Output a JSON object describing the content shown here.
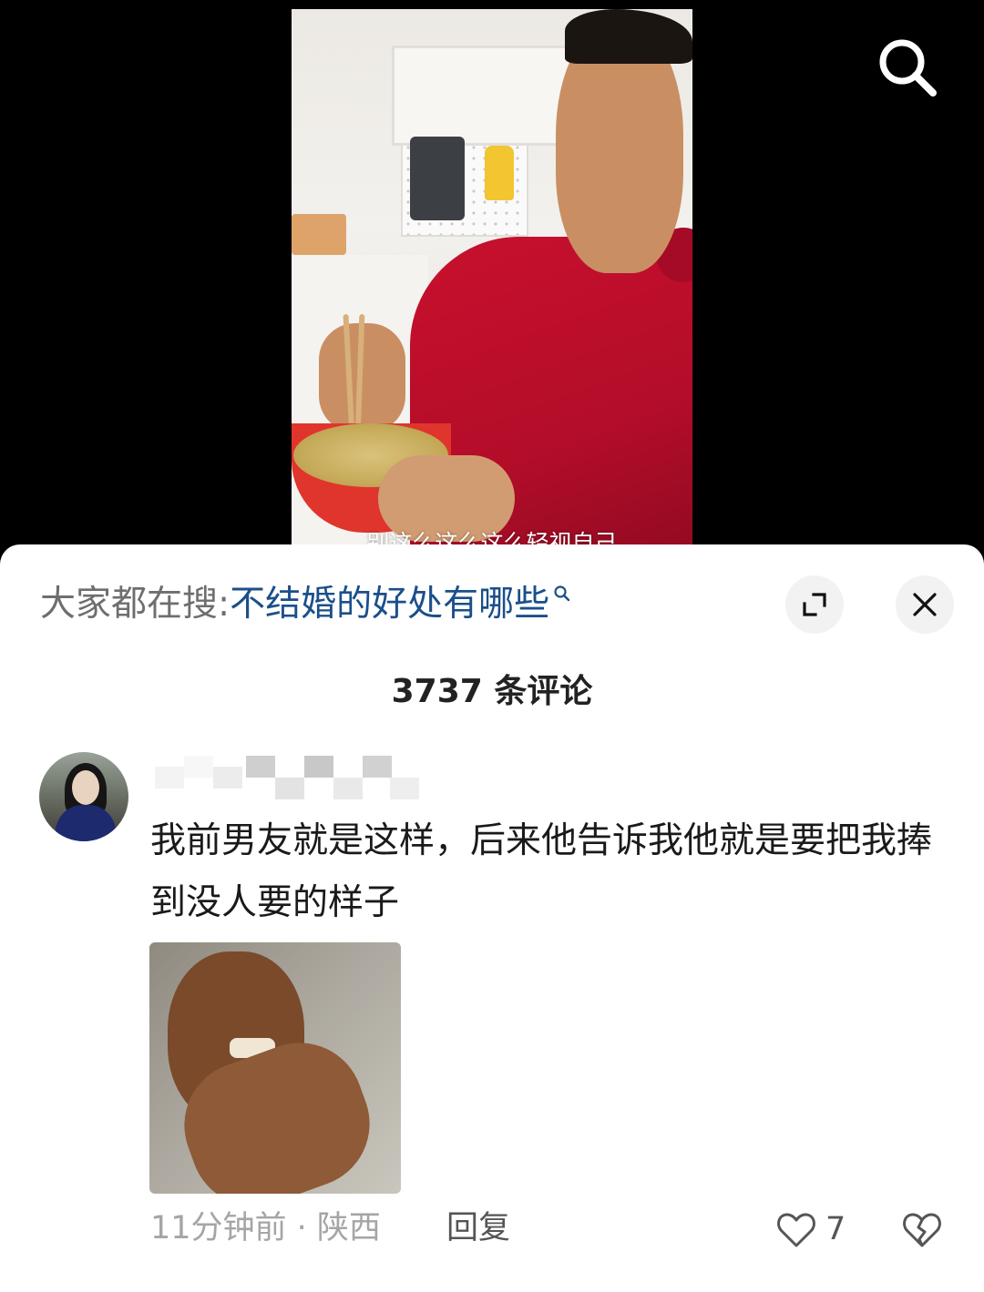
{
  "video": {
    "subtitle": "别这么这么这么轻视自己"
  },
  "icons": {
    "search": "search-icon",
    "expand": "expand-icon",
    "close": "close-icon",
    "trending_search": "search-small-icon",
    "like": "heart-icon",
    "dislike": "broken-heart-icon"
  },
  "trending": {
    "prefix": "大家都在搜:",
    "term": "不结婚的好处有哪些"
  },
  "comments_header": {
    "count_label": "3737 条评论"
  },
  "comment": {
    "text": "我前男友就是这样，后来他告诉我他就是要把我捧到没人要的样子",
    "meta": "11分钟前 · 陕西",
    "reply_label": "回复",
    "like_count": "7"
  },
  "colors": {
    "link_blue": "#1b4f8a",
    "meta_gray": "#a5a5a5",
    "jacket_red": "#c8102e"
  }
}
